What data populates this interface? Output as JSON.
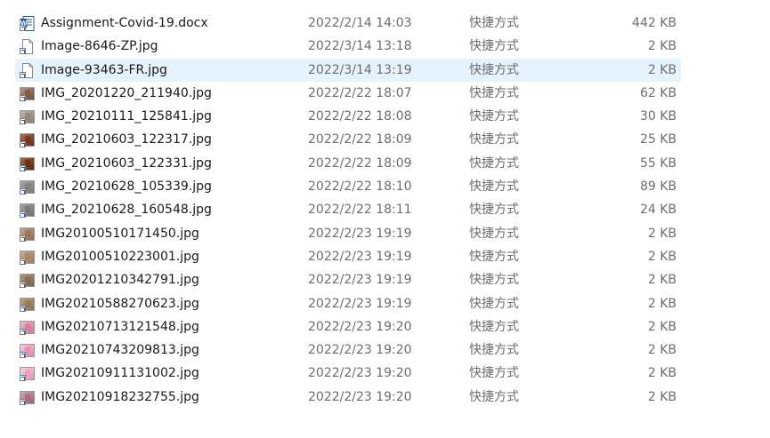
{
  "files": [
    {
      "name": "Assignment-Covid-19.docx",
      "modified": "2022/2/14 14:03",
      "type": "快捷方式",
      "size": "442 KB",
      "icon": "word-document-icon",
      "colors": [
        "#2b5797",
        "#2b5797"
      ]
    },
    {
      "name": "Image-8646-ZP.jpg",
      "modified": "2022/3/14 13:18",
      "type": "快捷方式",
      "size": "2 KB",
      "icon": "blank-file-icon",
      "colors": [
        "#ffffff",
        "#ffffff"
      ]
    },
    {
      "name": "Image-93463-FR.jpg",
      "modified": "2022/3/14 13:19",
      "type": "快捷方式",
      "size": "2 KB",
      "icon": "blank-file-icon",
      "colors": [
        "#ffffff",
        "#ffffff"
      ],
      "selected": true
    },
    {
      "name": "IMG_20201220_211940.jpg",
      "modified": "2022/2/22 18:07",
      "type": "快捷方式",
      "size": "62 KB",
      "icon": "image-thumbnail-icon",
      "colors": [
        "#6b4a3a",
        "#b89a80"
      ]
    },
    {
      "name": "IMG_20210111_125841.jpg",
      "modified": "2022/2/22 18:08",
      "type": "快捷方式",
      "size": "30 KB",
      "icon": "image-thumbnail-icon",
      "colors": [
        "#8a7a6a",
        "#c8b8a0"
      ]
    },
    {
      "name": "IMG_20210603_122317.jpg",
      "modified": "2022/2/22 18:09",
      "type": "快捷方式",
      "size": "25 KB",
      "icon": "image-thumbnail-icon",
      "colors": [
        "#5a2a1a",
        "#c07040"
      ]
    },
    {
      "name": "IMG_20210603_122331.jpg",
      "modified": "2022/2/22 18:09",
      "type": "快捷方式",
      "size": "55 KB",
      "icon": "image-thumbnail-icon",
      "colors": [
        "#4a2418",
        "#b06a3a"
      ]
    },
    {
      "name": "IMG_20210628_105339.jpg",
      "modified": "2022/2/22 18:10",
      "type": "快捷方式",
      "size": "89 KB",
      "icon": "image-thumbnail-icon",
      "colors": [
        "#7a7470",
        "#b0a8a0"
      ]
    },
    {
      "name": "IMG_20210628_160548.jpg",
      "modified": "2022/2/22 18:11",
      "type": "快捷方式",
      "size": "24 KB",
      "icon": "image-thumbnail-icon",
      "colors": [
        "#6a6a70",
        "#a8a8b0"
      ]
    },
    {
      "name": "IMG20100510171450.jpg",
      "modified": "2022/2/23 19:19",
      "type": "快捷方式",
      "size": "2 KB",
      "icon": "image-thumbnail-icon",
      "colors": [
        "#8a6a50",
        "#c8a888"
      ]
    },
    {
      "name": "IMG20100510223001.jpg",
      "modified": "2022/2/23 19:19",
      "type": "快捷方式",
      "size": "2 KB",
      "icon": "image-thumbnail-icon",
      "colors": [
        "#9a7a5a",
        "#d0b090"
      ]
    },
    {
      "name": "IMG20201210342791.jpg",
      "modified": "2022/2/23 19:19",
      "type": "快捷方式",
      "size": "2 KB",
      "icon": "image-thumbnail-icon",
      "colors": [
        "#7a6048",
        "#b89878"
      ]
    },
    {
      "name": "IMG20210588270623.jpg",
      "modified": "2022/2/23 19:19",
      "type": "快捷方式",
      "size": "2 KB",
      "icon": "image-thumbnail-icon",
      "colors": [
        "#8a7050",
        "#c0a080"
      ]
    },
    {
      "name": "IMG20210713121548.jpg",
      "modified": "2022/2/23 19:20",
      "type": "快捷方式",
      "size": "2 KB",
      "icon": "image-thumbnail-icon",
      "colors": [
        "#d07090",
        "#f0c0c8"
      ]
    },
    {
      "name": "IMG20210743209813.jpg",
      "modified": "2022/2/23 19:20",
      "type": "快捷方式",
      "size": "2 KB",
      "icon": "image-thumbnail-icon",
      "colors": [
        "#e080a8",
        "#f8d0e0"
      ]
    },
    {
      "name": "IMG20210911131002.jpg",
      "modified": "2022/2/23 19:20",
      "type": "快捷方式",
      "size": "2 KB",
      "icon": "image-thumbnail-icon",
      "colors": [
        "#e890a8",
        "#f8d8e0"
      ]
    },
    {
      "name": "IMG20210918232755.jpg",
      "modified": "2022/2/23 19:20",
      "type": "快捷方式",
      "size": "2 KB",
      "icon": "image-thumbnail-icon",
      "colors": [
        "#9a6070",
        "#d8a8b8"
      ]
    }
  ],
  "colors": {
    "selection": "#e5f3ff",
    "text": "#1a1a1a",
    "secondary_text": "#6d6d6d",
    "shortcut_arrow": "#1f5fbf"
  }
}
